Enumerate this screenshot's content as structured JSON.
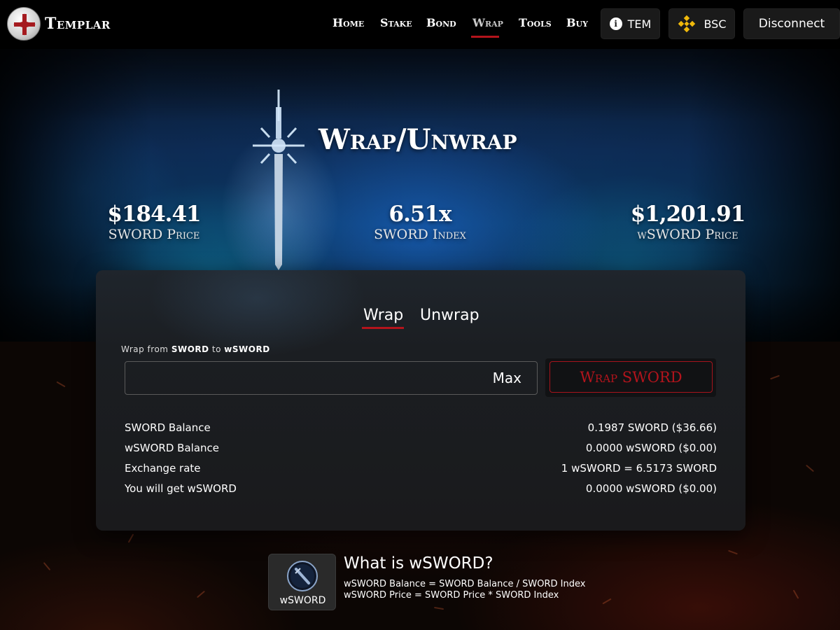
{
  "header": {
    "logo_text": "Templar",
    "nav": [
      {
        "label": "Home"
      },
      {
        "label": "Stake"
      },
      {
        "label": "Bond"
      },
      {
        "label": "Wrap",
        "active": true
      },
      {
        "label": "Tools"
      },
      {
        "label": "Buy"
      }
    ],
    "tem_label": "TEM",
    "network_label": "BSC",
    "disconnect_label": "Disconnect"
  },
  "hero": {
    "title": "Wrap/Unwrap",
    "stats": [
      {
        "value": "$184.41",
        "label": "SWORD Price"
      },
      {
        "value": "6.51x",
        "label": "SWORD Index"
      },
      {
        "value": "$1,201.91",
        "label": "wSWORD Price"
      }
    ]
  },
  "card": {
    "tabs": [
      {
        "label": "Wrap",
        "active": true
      },
      {
        "label": "Unwrap",
        "active": false
      }
    ],
    "desc_prefix": "Wrap from",
    "desc_from": "SWORD",
    "desc_mid": "to",
    "desc_to": "wSWORD",
    "input_value": "",
    "max_label": "Max",
    "action_label": "Wrap SWORD",
    "rows": [
      {
        "label": "SWORD Balance",
        "value": "0.1987 SWORD ($36.66)"
      },
      {
        "label": "wSWORD Balance",
        "value": "0.0000 wSWORD ($0.00)"
      },
      {
        "label": "Exchange rate",
        "value": "1 wSWORD = 6.5173 SWORD"
      },
      {
        "label": "You will get wSWORD",
        "value": "0.0000 wSWORD ($0.00)"
      }
    ]
  },
  "info": {
    "tile_label": "wSWORD",
    "title": "What is wSWORD?",
    "line1": "wSWORD Balance = SWORD Balance / SWORD Index",
    "line2": "wSWORD Price = SWORD Price * SWORD Index"
  },
  "colors": {
    "accent_red": "#b3141c",
    "header_bg": "#000000",
    "card_bg": "#1b1e22"
  }
}
